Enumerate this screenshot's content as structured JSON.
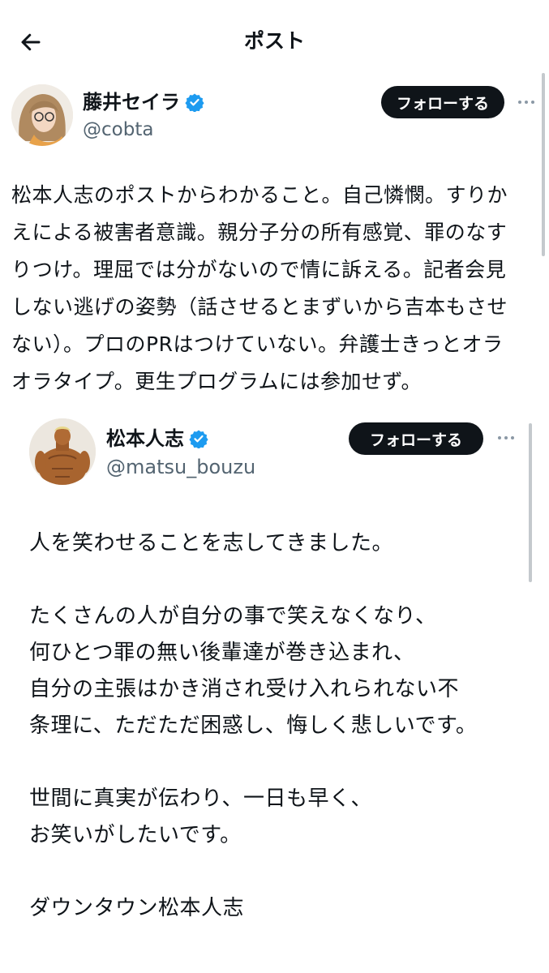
{
  "header": {
    "title": "ポスト"
  },
  "post": {
    "author": {
      "display_name": "藤井セイラ",
      "handle": "@cobta"
    },
    "follow_label": "フォローする",
    "text_lines": [
      "松本人志のポストからわかること。自己憐憫。すりか",
      "えによる被害者意識。親分子分の所有感覚、罪のなす",
      "りつけ。理屈では分がないので情に訴える。記者会見",
      "しない逃げの姿勢（話させるとまずいから吉本もさせ",
      "ない）。プロのPRはつけていない。弁護士きっとオラ",
      "オラタイプ。更生プログラムには参加せず。"
    ]
  },
  "quoted_post": {
    "author": {
      "display_name": "松本人志",
      "handle": "@matsu_bouzu"
    },
    "follow_label": "フォローする",
    "text_lines": [
      "人を笑わせることを志してきました。",
      "",
      "たくさんの人が自分の事で笑えなくなり、",
      "何ひとつ罪の無い後輩達が巻き込まれ、",
      "自分の主張はかき消され受け入れられない不",
      "条理に、ただただ困惑し、悔しく悲しいです。",
      "",
      "世間に真実が伝わり、一日も早く、",
      "お笑いがしたいです。",
      "",
      "ダウンタウン松本人志"
    ]
  },
  "icons": {
    "back": "arrow-left-icon",
    "verified": "verified-badge-icon",
    "more": "more-horizontal-icon"
  },
  "colors": {
    "verified": "#1d9bf0",
    "follow_button_bg": "#0f1419",
    "secondary_text": "#536471"
  }
}
